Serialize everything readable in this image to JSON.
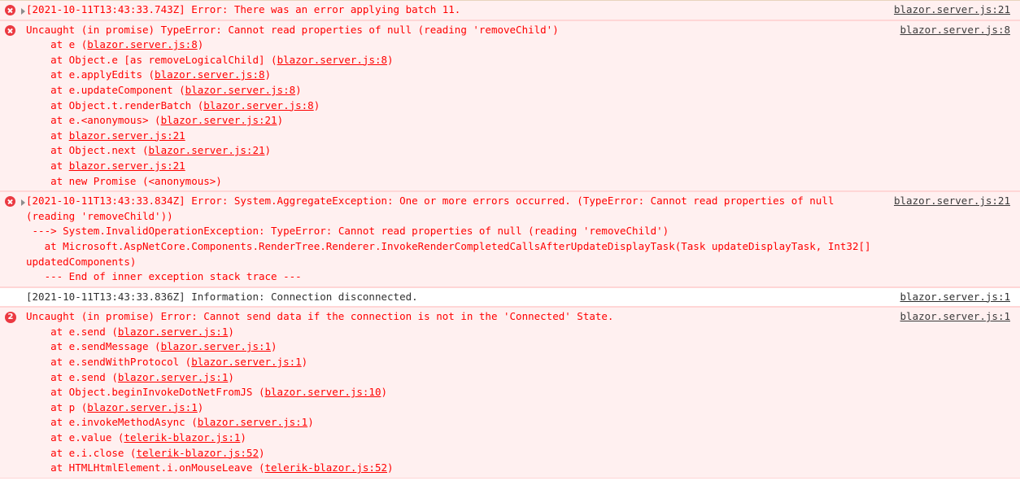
{
  "console": {
    "messages": [
      {
        "id": "msg-batch-error",
        "kind": "error",
        "icon": "error-circle-icon",
        "has_disclosure": true,
        "disclosure_state": "collapsed",
        "headline": "[2021-10-11T13:43:33.743Z] Error: There was an error applying batch 11.",
        "source": "blazor.server.js:21",
        "stack": []
      },
      {
        "id": "msg-typeerror-removechild",
        "kind": "error",
        "icon": "error-circle-icon",
        "has_disclosure": false,
        "headline": "Uncaught (in promise) TypeError: Cannot read properties of null (reading 'removeChild')",
        "source": "blazor.server.js:8",
        "stack": [
          "    at e (blazor.server.js:8)",
          "    at Object.e [as removeLogicalChild] (blazor.server.js:8)",
          "    at e.applyEdits (blazor.server.js:8)",
          "    at e.updateComponent (blazor.server.js:8)",
          "    at Object.t.renderBatch (blazor.server.js:8)",
          "    at e.<anonymous> (blazor.server.js:21)",
          "    at blazor.server.js:21",
          "    at Object.next (blazor.server.js:21)",
          "    at blazor.server.js:21",
          "    at new Promise (<anonymous>)"
        ]
      },
      {
        "id": "msg-aggregate-exception",
        "kind": "error",
        "icon": "error-circle-icon",
        "has_disclosure": true,
        "disclosure_state": "collapsed",
        "headline": "[2021-10-11T13:43:33.834Z] Error: System.AggregateException: One or more errors occurred. (TypeError: Cannot read properties of null (reading 'removeChild'))",
        "source": "blazor.server.js:21",
        "stack": [
          " ---> System.InvalidOperationException: TypeError: Cannot read properties of null (reading 'removeChild')",
          "   at Microsoft.AspNetCore.Components.RenderTree.Renderer.InvokeRenderCompletedCallsAfterUpdateDisplayTask(Task updateDisplayTask, Int32[] updatedComponents)",
          "   --- End of inner exception stack trace ---"
        ]
      },
      {
        "id": "msg-connection-disconnected",
        "kind": "info",
        "icon": null,
        "has_disclosure": false,
        "headline": "[2021-10-11T13:43:33.836Z] Information: Connection disconnected.",
        "source": "blazor.server.js:1",
        "stack": []
      },
      {
        "id": "msg-cannot-send-data",
        "kind": "error",
        "icon": "count-badge",
        "count": "2",
        "has_disclosure": false,
        "headline": "Uncaught (in promise) Error: Cannot send data if the connection is not in the 'Connected' State.",
        "source": "blazor.server.js:1",
        "stack": [
          "    at e.send (blazor.server.js:1)",
          "    at e.sendMessage (blazor.server.js:1)",
          "    at e.sendWithProtocol (blazor.server.js:1)",
          "    at e.send (blazor.server.js:1)",
          "    at Object.beginInvokeDotNetFromJS (blazor.server.js:10)",
          "    at p (blazor.server.js:1)",
          "    at e.invokeMethodAsync (blazor.server.js:1)",
          "    at e.value (telerik-blazor.js:1)",
          "    at e.i.close (telerik-blazor.js:52)",
          "    at HTMLHtmlElement.i.onMouseLeave (telerik-blazor.js:52)"
        ]
      }
    ],
    "colors": {
      "error_text": "#ff0000",
      "error_background": "#fff0f0",
      "error_border": "#ffd6d6",
      "icon_red": "#eb3941",
      "info_text": "#303030",
      "info_background": "#ffffff",
      "link_text": "#3b3b3b",
      "disclosure_gray": "#8c8c8c"
    }
  }
}
